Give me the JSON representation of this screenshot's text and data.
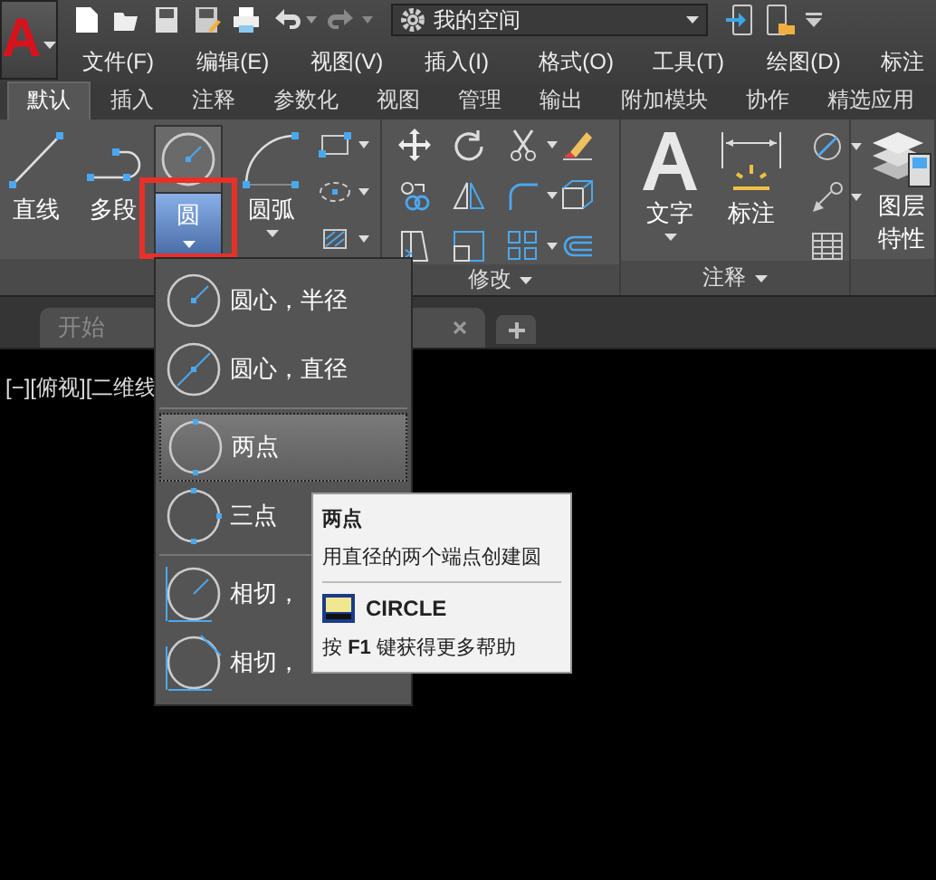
{
  "app_button": {
    "letter": "A"
  },
  "workspace": {
    "value": "我的空间"
  },
  "menu_bar": [
    {
      "label": "文件(F)"
    },
    {
      "label": "编辑(E)"
    },
    {
      "label": "视图(V)"
    },
    {
      "label": "插入(I)"
    },
    {
      "label": "格式(O)"
    },
    {
      "label": "工具(T)"
    },
    {
      "label": "绘图(D)"
    },
    {
      "label": "标注"
    }
  ],
  "ribbon_tabs": [
    {
      "label": "默认",
      "selected": true
    },
    {
      "label": "插入",
      "selected": false
    },
    {
      "label": "注释",
      "selected": false
    },
    {
      "label": "参数化",
      "selected": false
    },
    {
      "label": "视图",
      "selected": false
    },
    {
      "label": "管理",
      "selected": false
    },
    {
      "label": "输出",
      "selected": false
    },
    {
      "label": "附加模块",
      "selected": false
    },
    {
      "label": "协作",
      "selected": false
    },
    {
      "label": "精选应用",
      "selected": false
    }
  ],
  "draw_panel": {
    "tools": [
      {
        "label": "直线",
        "kind": "line",
        "pressed": false
      },
      {
        "label": "多段",
        "kind": "polyline",
        "pressed": false
      },
      {
        "label": "圆",
        "kind": "circle",
        "pressed": true,
        "marked": true
      },
      {
        "label": "圆弧",
        "kind": "arc",
        "pressed": false
      }
    ]
  },
  "modify_panel": {
    "title": "修改"
  },
  "annotation_panel": {
    "title": "注释",
    "tools": [
      {
        "label": "文字",
        "kind": "text"
      },
      {
        "label": "标注",
        "kind": "dimension"
      }
    ]
  },
  "layers_panel": {
    "lines": [
      "图层",
      "特性"
    ]
  },
  "document_tabs": [
    {
      "label": "开始"
    }
  ],
  "viewport_label": "[−][俯视][二维线",
  "circle_menu": {
    "groups": [
      [
        {
          "label": "圆心，半径",
          "kind": "center-radius",
          "selected": false
        },
        {
          "label": "圆心，直径",
          "kind": "center-diameter",
          "selected": false
        }
      ],
      [
        {
          "label": "两点",
          "kind": "two-point",
          "selected": true
        },
        {
          "label": "三点",
          "kind": "three-point",
          "selected": false
        }
      ],
      [
        {
          "label": "相切，",
          "kind": "tan-tan-radius",
          "selected": false
        },
        {
          "label": "相切，",
          "kind": "tan-tan-tan",
          "selected": false
        }
      ]
    ]
  },
  "tooltip": {
    "title": "两点",
    "description": "用直径的两个端点创建圆",
    "command": "CIRCLE",
    "help": "按 **F1** 键获得更多帮助"
  }
}
